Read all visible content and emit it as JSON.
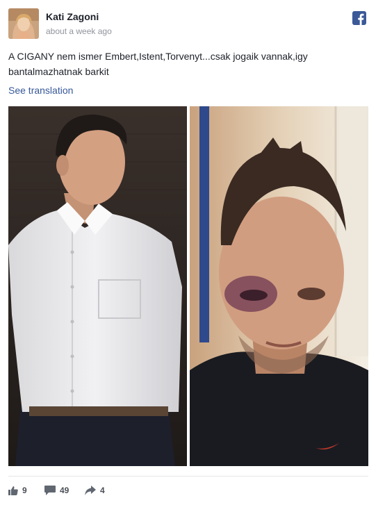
{
  "post": {
    "author_name": "Kati Zagoni",
    "timestamp": "about a week ago",
    "text": "A CIGANY nem ismer Embert,Istent,Torvenyt...csak jogaik vannak,igy bantalmazhatnak barkit",
    "translate_link": "See translation"
  },
  "images": [
    {
      "icon": "photo-man-white-shirt"
    },
    {
      "icon": "photo-man-bruised-eye"
    }
  ],
  "stats": {
    "likes": "9",
    "comments": "49",
    "shares": "4"
  },
  "colors": {
    "link": "#365899",
    "facebook_blue": "#3b5998",
    "meta_gray": "#90949c"
  }
}
